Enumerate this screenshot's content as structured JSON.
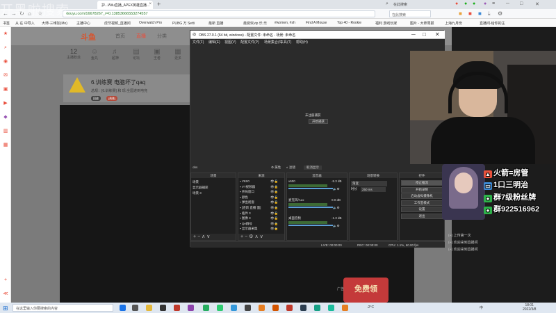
{
  "browser": {
    "tab_label": "护...Wilu直播_APEX英雄直播...",
    "extra_tab_label": "",
    "new_tab": "+",
    "tr_search_label": "在此搜索",
    "url": "douyu.com/16678267_r=0.13853666553274557",
    "search_placeholder": "在此搜索",
    "bookmarks": [
      "书签",
      "从 在 中导入",
      "大师-三维加(Mo)",
      "主播中心",
      "虎牙视频_直播间",
      "Overwatch Pro",
      "PUBG 万 Setti",
      "最新 直播",
      "最受欢vip 乐 乐",
      "#women, #sh",
      "Find A Mouse",
      "Top 40 - Rookie",
      "福利 游戏玩家 ",
      "图片 - 大师周报",
      "上海九月份 ",
      "直播间-给你的主"
    ]
  },
  "watermark": "开黑啦搜索",
  "douyu": {
    "logo": "斗鱼",
    "nav": [
      "首页",
      "直播",
      "分类"
    ],
    "cats": [
      {
        "num": "12",
        "label": "主播粉丝"
      },
      {
        "icon": "☺",
        "label": "鱼丸"
      },
      {
        "icon": "♬",
        "label": "超神"
      },
      {
        "icon": "▤",
        "label": "论坛"
      },
      {
        "icon": "▣",
        "label": "王者"
      },
      {
        "icon": "▦",
        "label": "更多"
      }
    ],
    "announce_title": "6.训练赛 电脑坏了qaq",
    "announce_sub": "总规：[6.训练赛] 和 现:全国进到电竞",
    "pills": [
      "回放",
      "[热练]"
    ],
    "gift_text": "免费领",
    "clip_label": "广告",
    "chat_lines": [
      "(+) 上传第一次 ",
      "(+) 欢迎来到直播间",
      "(+) 欢迎来到直播间"
    ]
  },
  "obs": {
    "title": "OBS 27.0.1 (64 bit, windows) - 配置文件: 未命名 - 场景: 未命名",
    "menus": [
      "文件(F)",
      "编辑(E)",
      "视图(V)",
      "配置文件(P)",
      "场景集合(S)",
      "工具(T)",
      "帮助(H)"
    ],
    "no_scene": "未注册捕获",
    "start_btn": "开始捕获",
    "ctrl_labels": [
      "obs",
      "属性",
      "滤镜",
      "取消显示"
    ],
    "docks": {
      "scenes": {
        "title": "场景",
        "items": [
          "场景",
          "显示器捕获",
          "场景 3"
        ]
      },
      "sources": {
        "title": "来源",
        "items": [
          "V6S0",
          "VT视频器",
          "开局窗口",
          "颜色",
          "弹出视窗",
          "[还新 直播 面]",
          "插件 3",
          "图像 3",
          "Qe群号",
          "显示器采集"
        ]
      },
      "mixer": {
        "title": "混音器",
        "labels": [
          "v600",
          "麦克风/Aux",
          "桌面音频"
        ],
        "db": [
          "-5.3 dB",
          "0.0 dB",
          "-1.3 dB"
        ]
      },
      "transitions": {
        "title": "场景转换",
        "type": "渐变",
        "duration_label": "时长",
        "duration": "250 ms"
      },
      "controls": {
        "title": "控件",
        "buttons": [
          "停止推流",
          "开始录制",
          "启动虚拟摄像机",
          "工作室模式",
          "设置",
          "退出"
        ]
      }
    },
    "status": [
      "LIVE: 00:00:00",
      "REC: 00:00:00",
      "CPU: 1.1%, 60.00 fps"
    ]
  },
  "overlay": {
    "lines": [
      "火箭=房管",
      "1口三明治",
      "群7级粉丝牌",
      "群922516962"
    ],
    "colors": [
      "#e8513c",
      "#3d8ad6",
      "#2eb24a",
      "#2eb24a"
    ]
  },
  "taskbar": {
    "search": "在这里输入你要搜索的内容",
    "temp": "-2°C",
    "lang": "中",
    "time": "18:01",
    "date": "2022/3/8"
  }
}
